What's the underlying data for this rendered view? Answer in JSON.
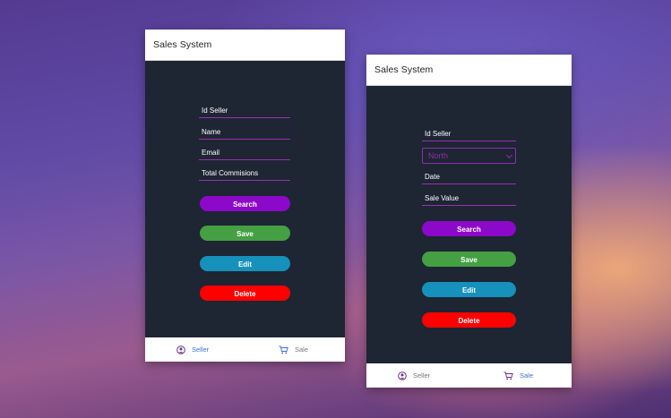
{
  "screens": [
    {
      "header": {
        "title": "Sales System"
      },
      "fields": [
        {
          "label": "Id Seller"
        },
        {
          "label": "Name"
        },
        {
          "label": "Email"
        },
        {
          "label": "Total Commisions"
        }
      ],
      "buttons": {
        "search": "Search",
        "save": "Save",
        "edit": "Edit",
        "delete": "Delete"
      },
      "tabs": {
        "seller": "Seller",
        "sale": "Sale",
        "active": "seller"
      }
    },
    {
      "header": {
        "title": "Sales System"
      },
      "fields": [
        {
          "label": "Id Seller"
        },
        {
          "label": "Date"
        },
        {
          "label": "Sale Value"
        }
      ],
      "region_select": {
        "value": "North"
      },
      "buttons": {
        "search": "Search",
        "save": "Save",
        "edit": "Edit",
        "delete": "Delete"
      },
      "tabs": {
        "seller": "Seller",
        "sale": "Sale",
        "active": "sale"
      }
    }
  ],
  "colors": {
    "screen_bg": "#1e2533",
    "accent_purple": "#8d09c9",
    "save_green": "#44a043",
    "edit_blue": "#1591bb",
    "delete_red": "#ff0000",
    "active_tab": "#3b6fd8"
  }
}
